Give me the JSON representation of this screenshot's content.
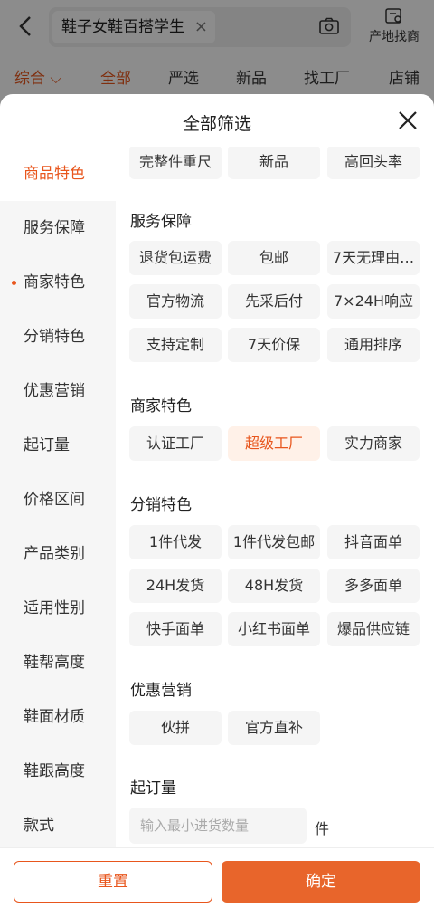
{
  "search": {
    "query": "鞋子女鞋百搭学生"
  },
  "origin_label": "产地找商",
  "tabs": [
    {
      "label": "综合 ⌵"
    },
    {
      "label": "全部"
    },
    {
      "label": "严选"
    },
    {
      "label": "新品"
    },
    {
      "label": "找工厂"
    },
    {
      "label": "店铺"
    }
  ],
  "sheet": {
    "title": "全部筛选"
  },
  "sidebar": [
    {
      "label": "商品特色"
    },
    {
      "label": "服务保障"
    },
    {
      "label": "商家特色"
    },
    {
      "label": "分销特色"
    },
    {
      "label": "优惠营销"
    },
    {
      "label": "起订量"
    },
    {
      "label": "价格区间"
    },
    {
      "label": "产品类别"
    },
    {
      "label": "适用性别"
    },
    {
      "label": "鞋帮高度"
    },
    {
      "label": "鞋面材质"
    },
    {
      "label": "鞋跟高度"
    },
    {
      "label": "款式"
    }
  ],
  "product_features": {
    "options": [
      "完整件重尺",
      "新品",
      "高回头率"
    ]
  },
  "service": {
    "title": "服务保障",
    "options": [
      "退货包运费",
      "包邮",
      "7天无理由…",
      "官方物流",
      "先采后付",
      "7×24H响应",
      "支持定制",
      "7天价保",
      "通用排序"
    ]
  },
  "merchant": {
    "title": "商家特色",
    "options": [
      "认证工厂",
      "超级工厂",
      "实力商家"
    ]
  },
  "distribution": {
    "title": "分销特色",
    "options": [
      "1件代发",
      "1件代发包邮",
      "抖音面单",
      "24H发货",
      "48H发货",
      "多多面单",
      "快手面单",
      "小红书面单",
      "爆品供应链"
    ]
  },
  "promo": {
    "title": "优惠营销",
    "options": [
      "伙拼",
      "官方直补"
    ]
  },
  "moq": {
    "title": "起订量",
    "placeholder": "输入最小进货数量",
    "unit": "件"
  },
  "footer": {
    "reset": "重置",
    "confirm": "确定"
  },
  "colors": {
    "accent": "#e8561d",
    "confirm_bg": "#e8652b",
    "selected_bg": "#fff1e8"
  }
}
